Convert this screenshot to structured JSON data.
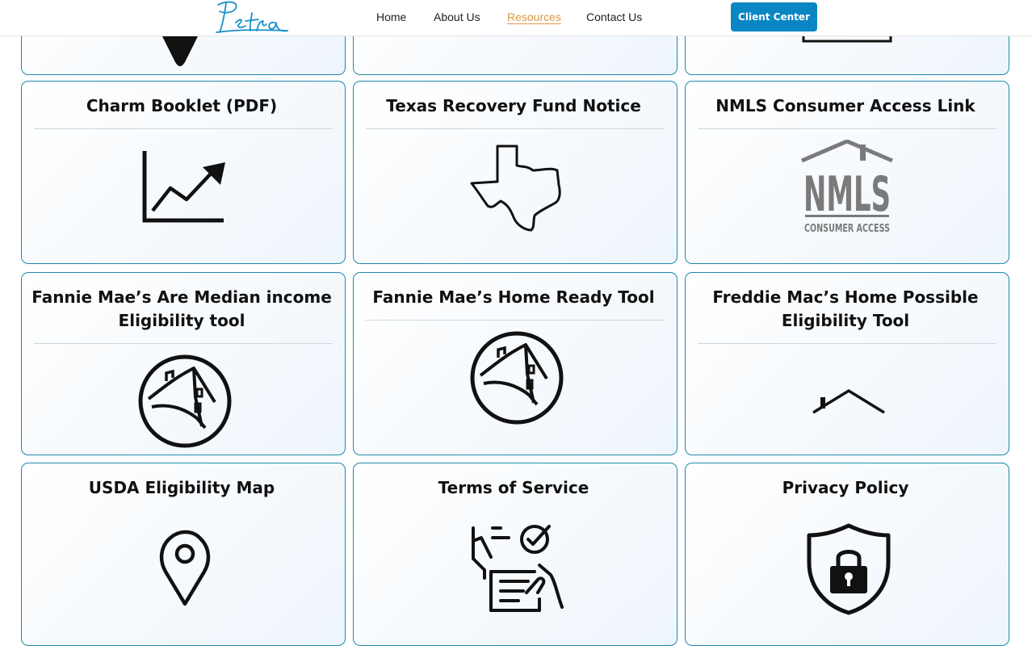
{
  "header": {
    "logo_text": "Petra",
    "nav": [
      {
        "label": "Home",
        "active": false
      },
      {
        "label": "About Us",
        "active": false
      },
      {
        "label": "Resources",
        "active": true
      },
      {
        "label": "Contact Us",
        "active": false
      }
    ],
    "client_button_label": "Client Center",
    "accent_color": "#0a86c4",
    "active_link_color": "#d99a4a"
  },
  "cards": [
    {
      "title": "",
      "icon": "chevron-down-icon"
    },
    {
      "title": "",
      "icon": "blank"
    },
    {
      "title": "",
      "icon": "frame-icon"
    },
    {
      "title": "Charm Booklet (PDF)",
      "icon": "chart-growth-icon"
    },
    {
      "title": "Texas Recovery Fund Notice",
      "icon": "texas-map-icon"
    },
    {
      "title": "NMLS Consumer Access Link",
      "icon": "nmls-logo-icon",
      "icon_text": "NMLS",
      "icon_subtext": "CONSUMER ACCESS"
    },
    {
      "title": "Fannie Mae’s Are Median income Eligibility tool",
      "icon": "fannie-mae-house-icon"
    },
    {
      "title": "Fannie Mae’s Home Ready Tool",
      "icon": "fannie-mae-house-icon"
    },
    {
      "title": "Freddie Mac’s Home Possible Eligibility Tool",
      "icon": "roof-icon"
    },
    {
      "title": "USDA Eligibility Map",
      "icon": "map-pin-icon"
    },
    {
      "title": "Terms of Service",
      "icon": "checklist-document-icon"
    },
    {
      "title": "Privacy Policy",
      "icon": "shield-lock-icon"
    }
  ],
  "colors": {
    "card_border": "#1e8aa8",
    "card_bg": "#eef5fc",
    "nmls_gray": "#7a7a7a"
  }
}
